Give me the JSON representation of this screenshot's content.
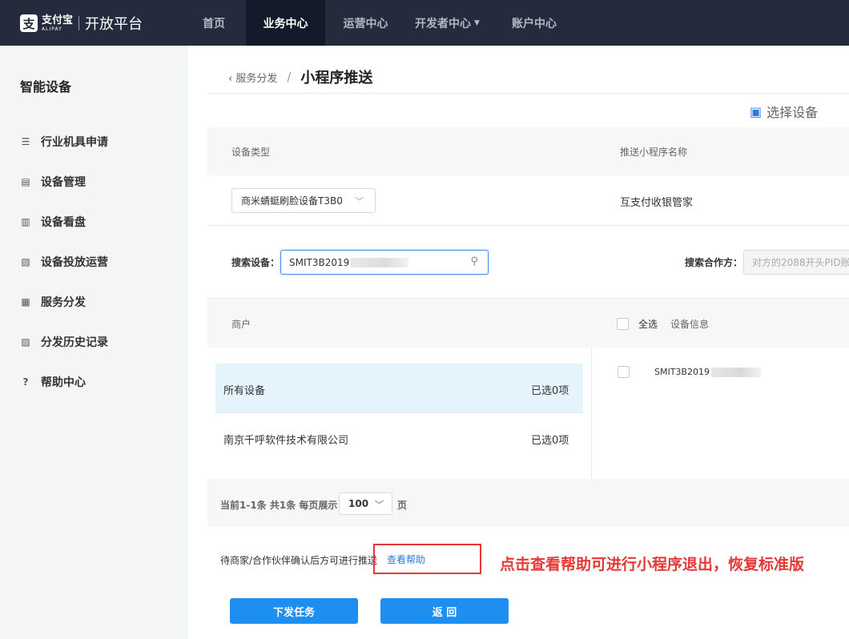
{
  "header": {
    "logo_mark": "支",
    "logo_cn": "支付宝",
    "logo_en": "ALIPAY",
    "platform_title": "开放平台",
    "nav": [
      {
        "label": "首页"
      },
      {
        "label": "业务中心",
        "active": true
      },
      {
        "label": "运营中心"
      },
      {
        "label": "开发者中心",
        "has_dropdown": true
      },
      {
        "label": "账户中心"
      }
    ]
  },
  "sidebar": {
    "title": "智能设备",
    "items": [
      {
        "label": "行业机具申请",
        "icon": "list-icon"
      },
      {
        "label": "设备管理",
        "icon": "document-icon"
      },
      {
        "label": "设备看盘",
        "icon": "bar-chart-icon"
      },
      {
        "label": "设备投放运营",
        "icon": "document-search-icon"
      },
      {
        "label": "服务分发",
        "icon": "grid-icon"
      },
      {
        "label": "分发历史记录",
        "icon": "history-icon"
      },
      {
        "label": "帮助中心",
        "icon": "help-icon"
      }
    ]
  },
  "breadcrumb": {
    "back": "服务分发",
    "separator": "/",
    "current": "小程序推送"
  },
  "select_device": "选择设备",
  "table_header": {
    "device_type": "设备类型",
    "app_name": "推送小程序名称"
  },
  "device_type_value": "商米蜻蜓刷脸设备T3B0",
  "app_name_value": "互支付收银管家",
  "search": {
    "device_label": "搜索设备：",
    "device_value": "SMIT3B2019",
    "partner_label": "搜索合作方：",
    "partner_placeholder": "对方的2088开头PID账号"
  },
  "list": {
    "merchant_header": "商户",
    "select_all": "全选",
    "device_info_header": "设备信息",
    "merchants": [
      {
        "name": "所有设备",
        "count": "已选0项",
        "selected": true
      },
      {
        "name": "南京千呼软件技术有限公司",
        "count": "已选0项",
        "selected": false
      }
    ],
    "devices": [
      {
        "code": "SMIT3B2019"
      }
    ]
  },
  "pagination": {
    "summary": "当前1-1条 共1条 每页展示",
    "page_size": "100",
    "unit": "页"
  },
  "footer": {
    "note": "待商家/合作伙伴确认后方可进行推送",
    "help_link": "查看帮助",
    "annotation": "点击查看帮助可进行小程序退出，恢复标准版",
    "submit_button": "下发任务",
    "back_button": "返 回"
  },
  "colors": {
    "topbar": "#232b3c",
    "primary": "#1f8ef1",
    "annotation": "#e53935"
  }
}
